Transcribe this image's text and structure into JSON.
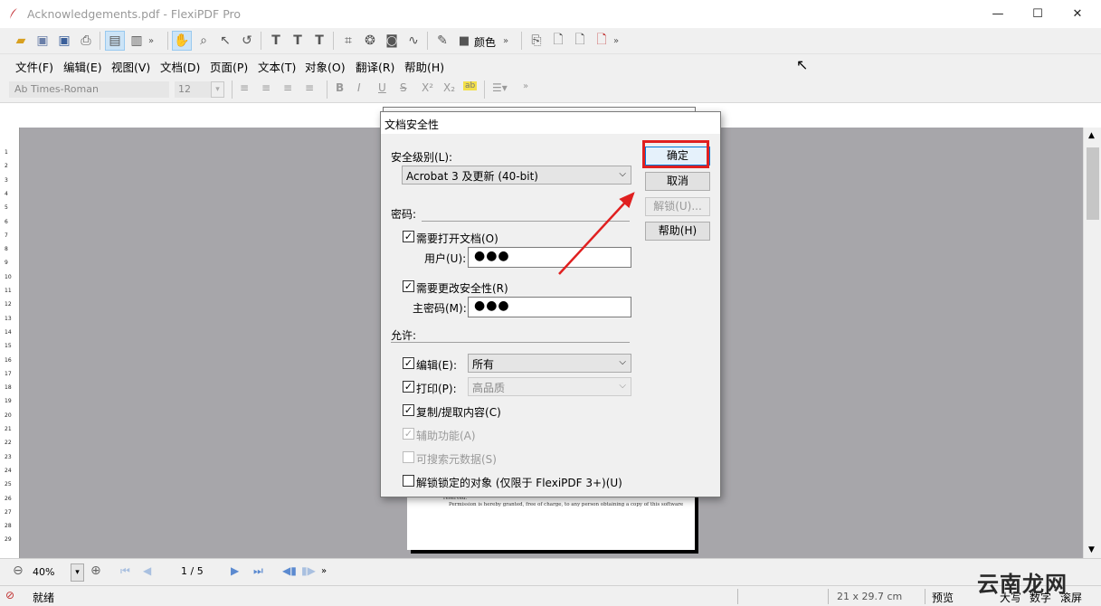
{
  "window": {
    "title": "Acknowledgements.pdf - FlexiPDF Pro",
    "minimize": "—",
    "maximize": "☐",
    "close": "✕"
  },
  "toolbar": {
    "color_label": "颜色"
  },
  "menu": [
    "文件(F)",
    "编辑(E)",
    "视图(V)",
    "文档(D)",
    "页面(P)",
    "文本(T)",
    "对象(O)",
    "翻译(R)",
    "帮助(H)"
  ],
  "format": {
    "font": "Ab Times-Roman",
    "size": "12",
    "buttons": [
      "B",
      "I",
      "U",
      "S",
      "X²",
      "X₂"
    ]
  },
  "dialog": {
    "title": "文档安全性",
    "security_level_label": "安全级别(L):",
    "security_level_value": "Acrobat 3 及更新 (40-bit)",
    "password_section": "密码:",
    "require_open_label": "需要打开文档(O)",
    "user_label": "用户(U):",
    "user_password": "●●●",
    "require_change_label": "需要更改安全性(R)",
    "master_label": "主密码(M):",
    "master_password": "●●●",
    "permissions_section": "允许:",
    "edit_label": "编辑(E):",
    "edit_value": "所有",
    "print_label": "打印(P):",
    "print_value": "高品质",
    "copy_label": "复制/提取内容(C)",
    "accessibility_label": "辅助功能(A)",
    "searchable_label": "可搜索元数据(S)",
    "unlock_label": "解锁锁定的对象 (仅限于 FlexiPDF 3+)(U)",
    "ok": "确定",
    "cancel": "取消",
    "unlock_btn": "解锁(U)...",
    "help": "帮助(H)"
  },
  "page_text": {
    "line1": "reserved.",
    "line2": "Permission is hereby granted, free of charge, to any person obtaining a copy of this software"
  },
  "ruler_numbers": [
    "1",
    "2",
    "3",
    "4",
    "5",
    "6",
    "7",
    "8",
    "9",
    "10",
    "11",
    "12",
    "13",
    "14",
    "15",
    "16",
    "17",
    "18",
    "19",
    "20",
    "21",
    "22",
    "23",
    "24",
    "25",
    "26",
    "27",
    "28",
    "29"
  ],
  "bottom": {
    "zoom": "40%",
    "page": "1 / 5"
  },
  "status": {
    "ready": "就绪",
    "page_size": "21 x 29.7 cm",
    "preview": "预览",
    "caps": "大写",
    "num": "数字",
    "scroll": "滚屏"
  },
  "watermark": "云南龙网",
  "colors": {
    "highlight": "#e02020",
    "arrow": "#e02020",
    "canvas": "#a7a6aa"
  }
}
